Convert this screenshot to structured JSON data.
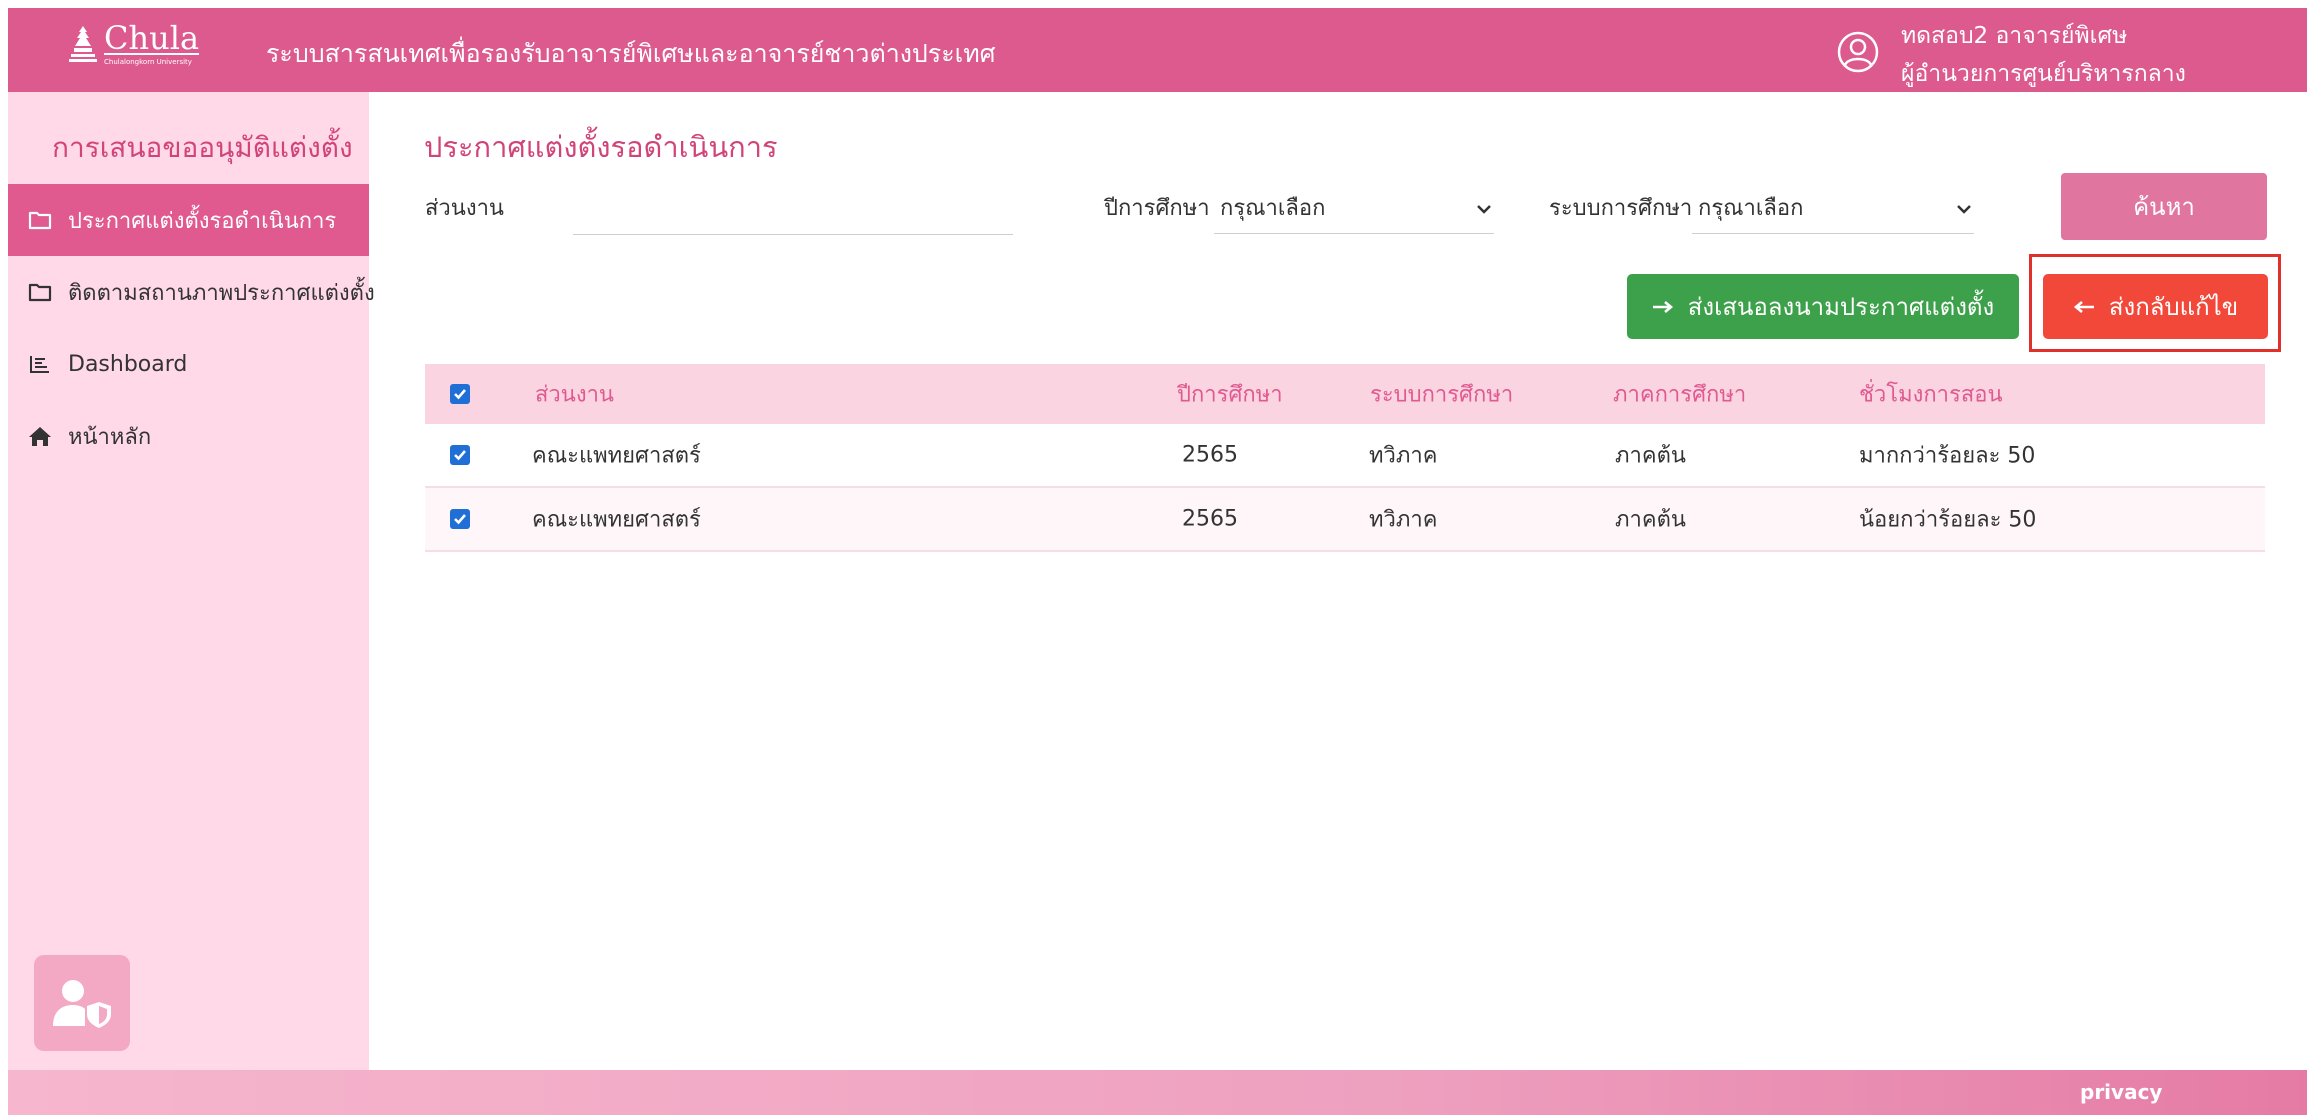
{
  "header": {
    "logo_text": "Chula",
    "logo_sub": "Chulalongkorn University",
    "system_title": "ระบบสารสนเทศเพื่อรองรับอาจารย์พิเศษและอาจารย์ชาวต่างประเทศ",
    "user_name": "ทดสอบ2 อาจารย์พิเศษ",
    "user_role": "ผู้อำนวยการศูนย์บริหารกลาง",
    "user_icon": "user-circle-icon"
  },
  "sidebar": {
    "title": "การเสนอขออนุมัติแต่งตั้ง",
    "items": [
      {
        "label": "ประกาศแต่งตั้งรอดำเนินการ",
        "icon": "folder-icon",
        "active": true
      },
      {
        "label": "ติดตามสถานภาพประกาศแต่งตั้ง",
        "icon": "folder-icon",
        "active": false
      },
      {
        "label": "Dashboard",
        "icon": "list-icon",
        "active": false
      },
      {
        "label": "หน้าหลัก",
        "icon": "home-icon",
        "active": false
      }
    ],
    "bottom_icon": "user-shield-icon"
  },
  "main": {
    "title": "ประกาศแต่งตั้งรอดำเนินการ",
    "filters": {
      "department_label": "ส่วนงาน",
      "department_value": "",
      "year_label": "ปีการศึกษา",
      "year_value": "กรุณาเลือก",
      "system_label": "ระบบการศึกษา",
      "system_value": "กรุณาเลือก",
      "search_button": "ค้นหา"
    },
    "actions": {
      "submit_label": "ส่งเสนอลงนามประกาศแต่งตั้ง",
      "return_label": "ส่งกลับแก้ไข"
    },
    "table": {
      "headers": [
        "ส่วนงาน",
        "ปีการศึกษา",
        "ระบบการศึกษา",
        "ภาคการศึกษา",
        "ชั่วโมงการสอน"
      ],
      "rows": [
        {
          "checked": true,
          "department": "คณะแพทยศาสตร์",
          "year": "2565",
          "system": "ทวิภาค",
          "semester": "ภาคต้น",
          "hours": "มากกว่าร้อยละ 50"
        },
        {
          "checked": true,
          "department": "คณะแพทยศาสตร์",
          "year": "2565",
          "system": "ทวิภาค",
          "semester": "ภาคต้น",
          "hours": "น้อยกว่าร้อยละ 50"
        }
      ]
    }
  },
  "footer": {
    "privacy": "privacy"
  },
  "colors": {
    "brand_pink": "#dd5a8e",
    "sidebar_bg": "#ffd9e7",
    "green": "#3ca14a",
    "red": "#f2483a",
    "checkbox": "#1f6fd6"
  }
}
